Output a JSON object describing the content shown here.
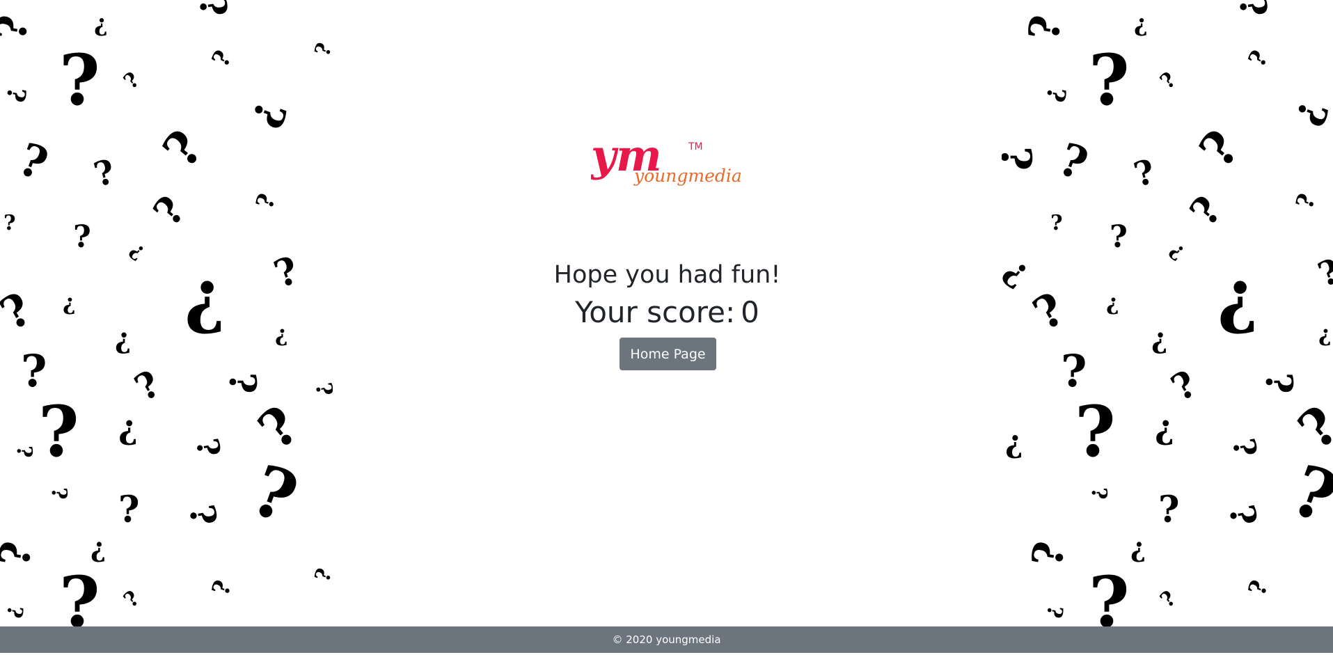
{
  "logo": {
    "mark": "ym",
    "trademark": "TM",
    "wordmark": "youngmedia",
    "mark_color": "#e8194a",
    "wordmark_color": "#e86a2b"
  },
  "result": {
    "message": "Hope you had fun!",
    "score_label": "Your score:",
    "score_value": "0"
  },
  "home_button": {
    "label": "Home Page"
  },
  "footer": {
    "text": "© 2020 youngmedia"
  },
  "colors": {
    "button_bg": "#6c757d",
    "footer_bg": "#6c757d",
    "text": "#212529"
  },
  "background_pattern": "question-marks"
}
